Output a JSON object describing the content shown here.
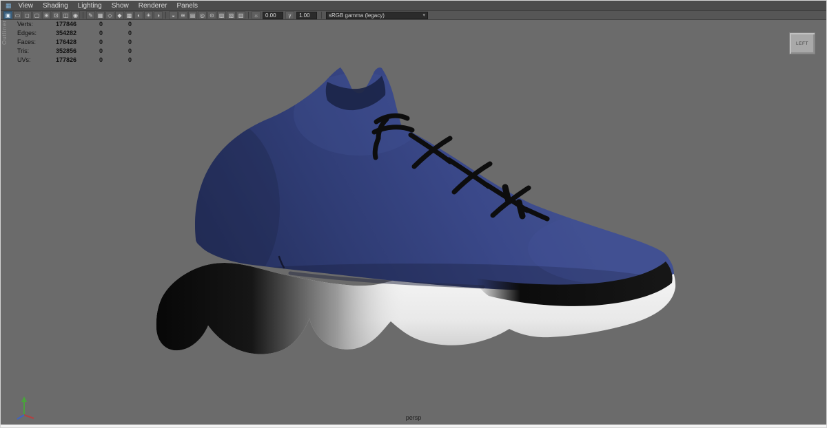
{
  "menu_bar": {
    "panel_icon": "▦",
    "items": [
      "View",
      "Shading",
      "Lighting",
      "Show",
      "Renderer",
      "Panels"
    ]
  },
  "toolbar": {
    "icons": [
      {
        "name": "single-pane-icon",
        "glyph": "▣"
      },
      {
        "name": "film-gate-icon",
        "glyph": "▭"
      },
      {
        "name": "resolution-gate-icon",
        "glyph": "◻"
      },
      {
        "name": "gate-mask-icon",
        "glyph": "▢"
      },
      {
        "name": "field-chart-icon",
        "glyph": "⊞"
      },
      {
        "name": "safe-action-icon",
        "glyph": "⊡"
      },
      {
        "name": "safe-title-icon",
        "glyph": "◫"
      },
      {
        "name": "camera-attributes-icon",
        "glyph": "◉"
      },
      {
        "name": "grease-pencil-icon",
        "glyph": "✎"
      },
      {
        "name": "grid-icon",
        "glyph": "▦"
      },
      {
        "name": "wireframe-icon",
        "glyph": "◇"
      },
      {
        "name": "smooth-shade-icon",
        "glyph": "◆"
      },
      {
        "name": "textured-icon",
        "glyph": "▩"
      },
      {
        "name": "default-material-icon",
        "glyph": "◐"
      },
      {
        "name": "lighting-icon",
        "glyph": "☀"
      },
      {
        "name": "shadows-icon",
        "glyph": "◑"
      },
      {
        "name": "ambient-occlusion-icon",
        "glyph": "◒"
      },
      {
        "name": "motion-blur-icon",
        "glyph": "≋"
      },
      {
        "name": "anti-aliasing-icon",
        "glyph": "▤"
      },
      {
        "name": "depth-of-field-icon",
        "glyph": "◎"
      },
      {
        "name": "isolate-select-icon",
        "glyph": "⊙"
      },
      {
        "name": "x-ray-icon",
        "glyph": "▨"
      },
      {
        "name": "x-ray-joints-icon",
        "glyph": "▧"
      },
      {
        "name": "plane-mode-icon",
        "glyph": "▥"
      },
      {
        "name": "exposure-icon",
        "glyph": "☼"
      },
      {
        "name": "gamma-icon",
        "glyph": "γ"
      }
    ],
    "exposure_value": "0.00",
    "gamma_value": "1.00",
    "colorspace_label": "sRGB gamma (legacy)",
    "dropdown_arrow": "▾"
  },
  "hud": {
    "rows": [
      {
        "label": "Verts:",
        "value": "177846",
        "c2": "0",
        "c3": "0"
      },
      {
        "label": "Edges:",
        "value": "354282",
        "c2": "0",
        "c3": "0"
      },
      {
        "label": "Faces:",
        "value": "176428",
        "c2": "0",
        "c3": "0"
      },
      {
        "label": "Tris:",
        "value": "352856",
        "c2": "0",
        "c3": "0"
      },
      {
        "label": "UVs:",
        "value": "177826",
        "c2": "0",
        "c3": "0"
      }
    ]
  },
  "viewport": {
    "camera_label": "persp",
    "view_cube_label": "LEFT",
    "side_panel_label": "Outliner"
  },
  "colors": {
    "viewport_bg": "#6b6b6b",
    "menubar_bg": "#4c4c4c",
    "toolbar_bg": "#565656",
    "shoe_upper_blue": "#34417e",
    "shoe_upper_dark": "#222c54",
    "sole_white": "#ececec",
    "sole_heel_black": "#0b0b0b",
    "lace_black": "#0d0d0d"
  }
}
